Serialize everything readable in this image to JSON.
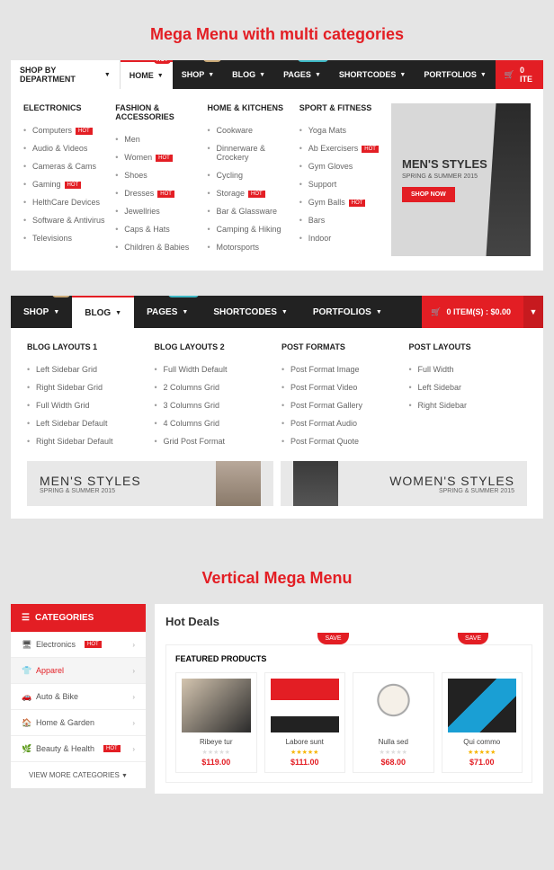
{
  "title1": "Mega Menu with multi categories",
  "title2": "Vertical Mega Menu",
  "nav1": {
    "dept": "SHOP BY DEPARTMENT",
    "items": [
      "HOME",
      "SHOP",
      "BLOG",
      "PAGES",
      "SHORTCODES",
      "PORTFOLIOS"
    ],
    "cart": "0  ITE"
  },
  "mega1": {
    "cols": [
      {
        "h": "ELECTRONICS",
        "items": [
          {
            "t": "Computers",
            "b": "HOT"
          },
          {
            "t": "Audio & Videos"
          },
          {
            "t": "Cameras & Cams"
          },
          {
            "t": "Gaming",
            "b": "HOT"
          },
          {
            "t": "HelthCare Devices"
          },
          {
            "t": "Software & Antivirus"
          },
          {
            "t": "Televisions"
          }
        ]
      },
      {
        "h": "FASHION & ACCESSORIES",
        "items": [
          {
            "t": "Men"
          },
          {
            "t": "Women",
            "b": "HOT"
          },
          {
            "t": "Shoes"
          },
          {
            "t": "Dresses",
            "b": "HOT"
          },
          {
            "t": "Jewellries"
          },
          {
            "t": "Caps & Hats"
          },
          {
            "t": "Children & Babies"
          }
        ]
      },
      {
        "h": "HOME & KITCHENS",
        "items": [
          {
            "t": "Cookware"
          },
          {
            "t": "Dinnerware & Crockery"
          },
          {
            "t": "Cycling"
          },
          {
            "t": "Storage",
            "b": "HOT"
          },
          {
            "t": "Bar & Glassware"
          },
          {
            "t": "Camping & Hiking"
          },
          {
            "t": "Motorsports"
          }
        ]
      },
      {
        "h": "SPORT & FITNESS",
        "items": [
          {
            "t": "Yoga Mats"
          },
          {
            "t": "Ab Exercisers",
            "b": "HOT"
          },
          {
            "t": "Gym Gloves"
          },
          {
            "t": "Support"
          },
          {
            "t": "Gym Balls",
            "b": "HOT"
          },
          {
            "t": "Bars"
          },
          {
            "t": "Indoor"
          }
        ]
      }
    ],
    "promo": {
      "h": "MEN'S STYLES",
      "p": "SPRING & SUMMER 2015",
      "btn": "SHOP NOW"
    }
  },
  "nav2": {
    "items": [
      "SHOP",
      "BLOG",
      "PAGES",
      "SHORTCODES",
      "PORTFOLIOS"
    ],
    "cart": "0 ITEM(S) : $0.00"
  },
  "mega2": {
    "cols": [
      {
        "h": "BLOG LAYOUTS 1",
        "items": [
          "Left Sidebar Grid",
          "Right Sidebar Grid",
          "Full Width Grid",
          "Left Sidebar Default",
          "Right Sidebar Default"
        ]
      },
      {
        "h": "BLOG LAYOUTS 2",
        "items": [
          "Full Width Default",
          "2 Columns Grid",
          "3 Columns Grid",
          "4 Columns Grid",
          "Grid Post Format"
        ]
      },
      {
        "h": "POST FORMATS",
        "items": [
          "Post Format Image",
          "Post Format Video",
          "Post Format Gallery",
          "Post Format Audio",
          "Post Format Quote"
        ]
      },
      {
        "h": "POST LAYOUTS",
        "items": [
          "Full Width",
          "Left Sidebar",
          "Right Sidebar"
        ]
      }
    ],
    "ban1": {
      "h": "MEN'S STYLES",
      "p": "SPRING & SUMMER 2015"
    },
    "ban2": {
      "h": "WOMEN'S STYLES",
      "p": "SPRING & SUMMER 2015"
    }
  },
  "side": {
    "hd": "CATEGORIES",
    "items": [
      {
        "t": "Electronics",
        "b": "HOT"
      },
      {
        "t": "Apparel",
        "active": true
      },
      {
        "t": "Auto & Bike"
      },
      {
        "t": "Home & Garden"
      },
      {
        "t": "Beauty & Health",
        "b": "HOT"
      }
    ],
    "more": "VIEW MORE CATEGORIES"
  },
  "main": {
    "hd": "Hot Deals",
    "save": "SAVE",
    "feat": "FEATURED PRODUCTS",
    "prods": [
      {
        "n": "Ribeye tur",
        "p": "$119.00",
        "s": false
      },
      {
        "n": "Labore sunt",
        "p": "$111.00",
        "s": true
      },
      {
        "n": "Nulla sed",
        "p": "$68.00",
        "s": false
      },
      {
        "n": "Qui commo",
        "p": "$71.00",
        "s": true
      }
    ]
  }
}
